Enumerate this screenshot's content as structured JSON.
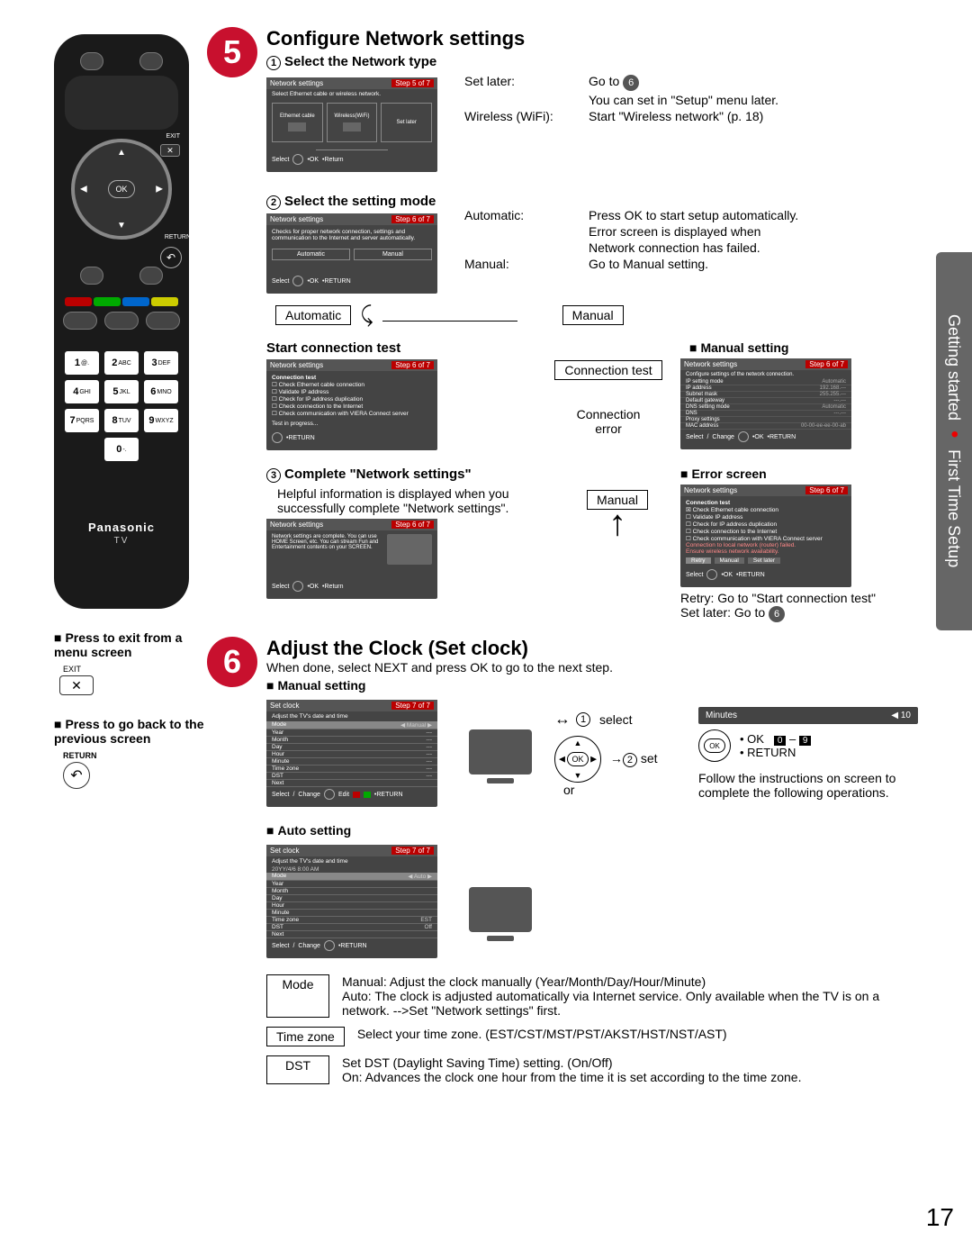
{
  "page_number": "17",
  "side_tab": {
    "line1": "Getting started",
    "line2": "First Time Setup"
  },
  "remote": {
    "ok": "OK",
    "exit_label": "EXIT",
    "return_label": "RETURN",
    "keys": [
      "1 @.",
      "2 ABC",
      "3 DEF",
      "4 GHI",
      "5 JKL",
      "6 MNO",
      "7 PQRS",
      "8 TUV",
      "9 WXYZ",
      "",
      "0 -.",
      ""
    ],
    "brand": "Panasonic",
    "brand_sub": "TV"
  },
  "left_hints": {
    "exit_title": "Press to exit from a menu screen",
    "exit_label": "EXIT",
    "return_title": "Press to go back to the previous screen",
    "return_label": "RETURN"
  },
  "step5": {
    "num": "5",
    "title": "Configure Network settings",
    "sub1": "Select the Network type",
    "screen1": {
      "title": "Network settings",
      "step": "Step 5 of 7",
      "note": "Select Ethernet cable or wireless network.",
      "opt1": "Ethernet cable",
      "opt2": "Wireless(WiFi)",
      "opt3": "Set later",
      "ftr_ok": "OK",
      "ftr_ret": "Return",
      "ftr_sel": "Select"
    },
    "right1": [
      {
        "k": "Set later:",
        "v": "Go to"
      },
      {
        "k": "",
        "v": "You can set in \"Setup\" menu later."
      },
      {
        "k": "Wireless (WiFi):",
        "v": "Start \"Wireless network\" (p. 18)"
      }
    ],
    "sub2": "Select the setting mode",
    "screen2": {
      "title": "Network settings",
      "step": "Step 6 of 7",
      "note": "Checks for proper network connection, settings and communication to the Internet and server automatically.",
      "opt1": "Automatic",
      "opt2": "Manual",
      "ftr_ok": "OK",
      "ftr_ret": "RETURN",
      "ftr_sel": "Select"
    },
    "right2": [
      {
        "k": "Automatic:",
        "v": "Press OK to start setup automatically."
      },
      {
        "k": "",
        "v": "Error screen is displayed when"
      },
      {
        "k": "",
        "v": "Network connection has failed."
      },
      {
        "k": "Manual:",
        "v": "Go to Manual setting."
      }
    ],
    "box_auto": "Automatic",
    "box_manual": "Manual",
    "start_test": "Start connection test",
    "manual_setting": "Manual setting",
    "conn_test": "Connection test",
    "conn_error": "Connection error",
    "screen_test": {
      "title": "Network settings",
      "step": "Step 6 of 7",
      "heading": "Connection test",
      "l1": "Check Ethernet cable connection",
      "l2": "Validate IP address",
      "l3": "Check for IP address duplication",
      "l4": "Check connection to the Internet",
      "l5": "Check communication with VIERA Connect server",
      "prog": "Test in progress...",
      "ftr_ret": "RETURN"
    },
    "screen_manual": {
      "title": "Network settings",
      "step": "Step 6 of 7",
      "sub": "Configure settings of the network connection.",
      "rows": [
        [
          "IP setting mode",
          "Automatic"
        ],
        [
          "IP address",
          "192.168.---"
        ],
        [
          "Subnet mask",
          "255.255.---"
        ],
        [
          "Default gateway",
          "---.---"
        ],
        [
          "DNS setting mode",
          "Automatic"
        ],
        [
          "DNS",
          "---.---"
        ],
        [
          "Proxy settings",
          ""
        ],
        [
          "MAC address",
          "00-00-ee-ee-00-ab"
        ]
      ],
      "ftr_ok": "OK",
      "ftr_ret": "RETURN",
      "ftr_sel": "Select",
      "ftr_chg": "Change"
    },
    "sub3": "Complete \"Network settings\"",
    "sub3_desc1": "Helpful information is displayed when you",
    "sub3_desc2": "successfully complete \"Network settings\".",
    "error_screen": "Error screen",
    "screen_complete": {
      "title": "Network settings",
      "step": "Step 6 of 7",
      "body": "Network settings are complete. You can use HOME Screen, etc. You can stream Fun and Entertainment contents on your SCREEN.",
      "ftr_ok": "OK",
      "ftr_ret": "Return",
      "ftr_sel": "Select"
    },
    "screen_error": {
      "title": "Network settings",
      "step": "Step 6 of 7",
      "heading": "Connection test",
      "l1": "Check Ethernet cable connection",
      "l2": "Validate IP address",
      "l3": "Check for IP address duplication",
      "l4": "Check connection to the Internet",
      "l5": "Check communication with VIERA Connect server",
      "l6": "Connection to local network (router) failed.",
      "l7": "Ensure wireless network availability.",
      "b1": "Retry",
      "b2": "Manual",
      "b3": "Set later",
      "ftr_ok": "OK",
      "ftr_ret": "RETURN",
      "ftr_sel": "Select"
    },
    "retry_txt": "Retry: Go to \"Start connection test\"",
    "setlater_txt": "Set later: Go to",
    "box_manual2": "Manual"
  },
  "step6": {
    "num": "6",
    "title": "Adjust the Clock (Set clock)",
    "desc": "When done, select NEXT and press OK to go to the next step.",
    "manual": "Manual setting",
    "auto": "Auto setting",
    "screen_manual_clock": {
      "title": "Set clock",
      "step": "Step 7 of 7",
      "sub": "Adjust the TV's date and time",
      "rows": [
        [
          "Mode",
          "Manual"
        ],
        [
          "Year",
          "---"
        ],
        [
          "Month",
          "---"
        ],
        [
          "Day",
          "---"
        ],
        [
          "Hour",
          "---"
        ],
        [
          "Minute",
          "---"
        ],
        [
          "Time zone",
          "---"
        ],
        [
          "DST",
          "---"
        ],
        [
          "Next",
          ""
        ]
      ],
      "ftr_sel": "Select",
      "ftr_chg": "Change",
      "ftr_edit": "Edit",
      "ftr_ret": "RETURN"
    },
    "screen_auto_clock": {
      "title": "Set clock",
      "step": "Step 7 of 7",
      "sub": "Adjust the TV's date and time",
      "date": "20YY/4/6   8:00 AM",
      "rows": [
        [
          "Mode",
          "Auto"
        ],
        [
          "Year",
          ""
        ],
        [
          "Month",
          ""
        ],
        [
          "Day",
          ""
        ],
        [
          "Hour",
          ""
        ],
        [
          "Minute",
          ""
        ],
        [
          "Time zone",
          "EST"
        ],
        [
          "DST",
          "Off"
        ],
        [
          "Next",
          ""
        ]
      ],
      "ftr_sel": "Select",
      "ftr_chg": "Change",
      "ftr_ret": "RETURN"
    },
    "label_select": "select",
    "label_set": "set",
    "label_or": "or",
    "minutes_box": "Minutes",
    "minutes_val": "10",
    "num0": "0",
    "num9": "9",
    "ok_lbl": "OK",
    "ret_lbl": "RETURN",
    "follow_txt": "Follow the instructions on screen to complete the following operations.",
    "mode_box": "Mode",
    "tz_box": "Time zone",
    "dst_box": "DST",
    "mode_desc1": "Manual: Adjust the clock manually (Year/Month/Day/Hour/Minute)",
    "mode_desc2": "Auto: The clock is adjusted automatically via Internet service. Only available when the TV is on a network. -->Set \"Network settings\" first.",
    "tz_desc": "Select your time zone. (EST/CST/MST/PST/AKST/HST/NST/AST)",
    "dst_desc1": "Set DST (Daylight Saving Time) setting. (On/Off)",
    "dst_desc2": "On: Advances the clock one hour from the time it is set according to the time zone."
  }
}
